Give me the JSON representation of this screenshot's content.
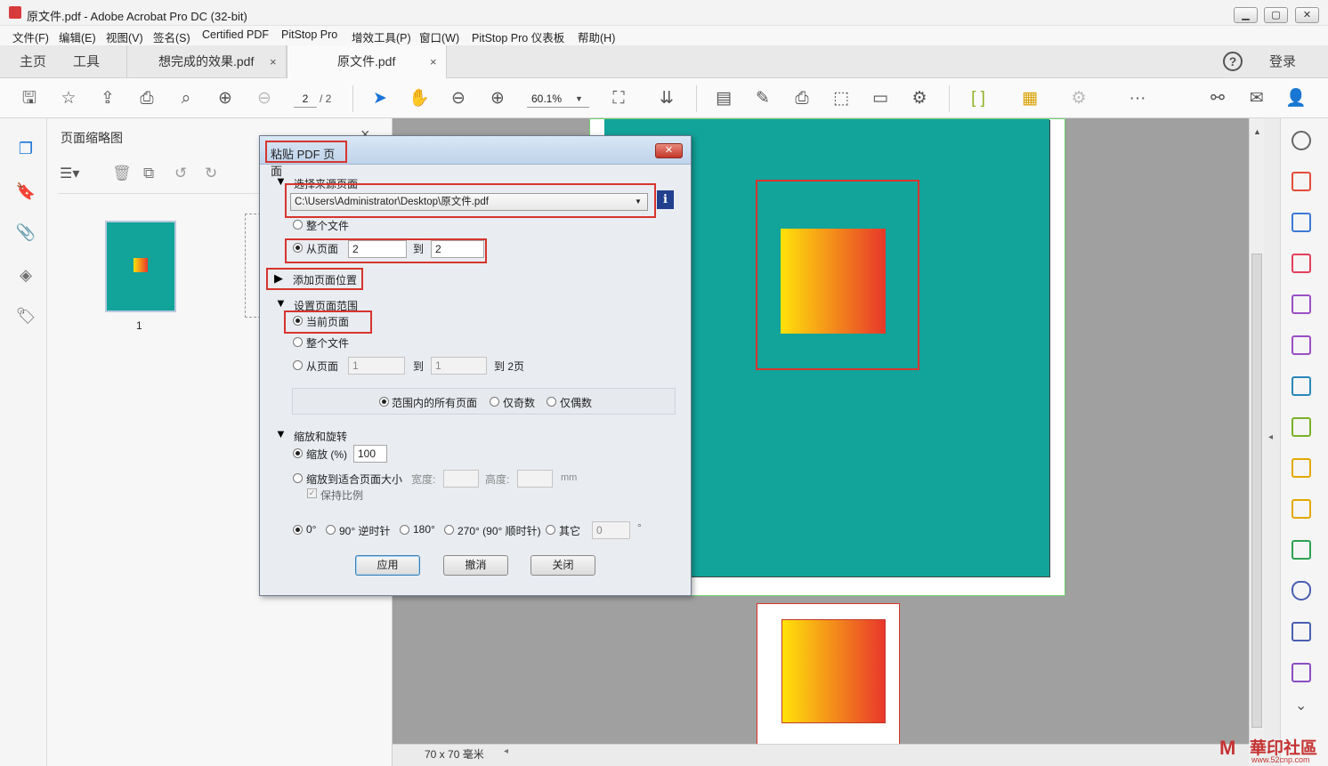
{
  "window": {
    "title": "原文件.pdf - Adobe Acrobat Pro DC (32-bit)",
    "min": "▁",
    "max": "▢",
    "close": "✕"
  },
  "menu": [
    "文件(F)",
    "编辑(E)",
    "视图(V)",
    "签名(S)",
    "Certified PDF",
    "PitStop Pro",
    "增效工具(P)",
    "窗口(W)",
    "PitStop Pro 仪表板",
    "帮助(H)"
  ],
  "tabs": {
    "home": "主页",
    "tools": "工具",
    "doc1": "想完成的效果.pdf",
    "doc2": "原文件.pdf",
    "close": "×",
    "help": "?",
    "login": "登录"
  },
  "toolbar": {
    "page_current": "2",
    "page_total": "/ 2",
    "zoom": "60.1%"
  },
  "thumbs": {
    "panel_title": "页面缩略图",
    "close": "×",
    "page1_label": "1"
  },
  "dialog": {
    "title": "粘贴 PDF 页面",
    "close": "✕",
    "source_section": "选择来源页面",
    "source_path": "C:\\Users\\Administrator\\Desktop\\原文件.pdf",
    "whole_file": "整个文件",
    "from_page": "从页面",
    "from_value": "2",
    "to": "到",
    "to_value": "2",
    "add_position": "添加页面位置",
    "set_range": "设置页面范围",
    "current_page": "当前页面",
    "range_whole_file": "整个文件",
    "range_from_page": "从页面",
    "range_from_value": "1",
    "range_to": "到",
    "range_to_value": "1",
    "range_to_total": "到 2页",
    "all_pages": "范围内的所有页面",
    "odd_only": "仅奇数",
    "even_only": "仅偶数",
    "scale_rotate": "缩放和旋转",
    "scale_pct": "缩放 (%)",
    "scale_value": "100",
    "fit_page": "缩放到适合页面大小",
    "width": "宽度:",
    "height": "高度:",
    "mm": "mm",
    "keep_ratio": "保持比例",
    "rot0": "0°",
    "rot90": "90° 逆时针",
    "rot180": "180°",
    "rot270": "270° (90° 顺时针)",
    "rot_other": "其它",
    "rot_other_value": "0",
    "degree": "°",
    "apply": "应用",
    "cancel": "撤消",
    "close_btn": "关闭"
  },
  "status": {
    "size": "70 x 70 毫米"
  },
  "watermark": {
    "text": "華印社區",
    "url": "www.52cnp.com"
  },
  "colors": {
    "teal": "#12a39a",
    "highlight_red": "#d6352d",
    "gradient_start": "#ffe20a",
    "gradient_end": "#e8372b"
  }
}
